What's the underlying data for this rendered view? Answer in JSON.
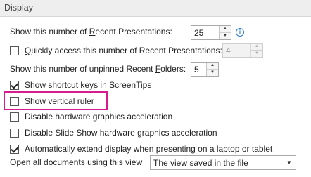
{
  "section": {
    "title": "Display"
  },
  "recent_presentations": {
    "label_pre": "Show this number of ",
    "label_u": "R",
    "label_post": "ecent Presentations:",
    "value": "25"
  },
  "quick_access": {
    "label_u": "Q",
    "label_post": "uickly access this number of Recent Presentations:",
    "checked": false,
    "value": "4"
  },
  "recent_folders": {
    "label_pre": "Show this number of unpinned Recent ",
    "label_u": "F",
    "label_post": "olders:",
    "value": "5"
  },
  "shortcut_keys": {
    "label_pre": "Show s",
    "label_u": "h",
    "label_post": "ortcut keys in ScreenTips",
    "checked": true
  },
  "vertical_ruler": {
    "label_pre": "Show ",
    "label_u": "v",
    "label_post": "ertical ruler",
    "checked": false
  },
  "hw_accel": {
    "label": "Disable hardware graphics acceleration",
    "checked": false
  },
  "slideshow_accel": {
    "label_pre": "Disable Slide Show hardware ",
    "label_u": "g",
    "label_post": "raphics acceleration",
    "checked": false
  },
  "auto_extend": {
    "label": "Automatically extend display when presenting on a laptop or tablet",
    "checked": true
  },
  "open_documents": {
    "label_u": "O",
    "label_post": "pen all documents using this view",
    "selected": "The view saved in the file"
  },
  "icons": {
    "info": "info-icon",
    "spin_up": "▲",
    "spin_down": "▼",
    "dropdown": "▼"
  },
  "colors": {
    "highlight": "#d81b8e",
    "info": "#2b7bd4",
    "header_bg": "#eeeeee"
  }
}
